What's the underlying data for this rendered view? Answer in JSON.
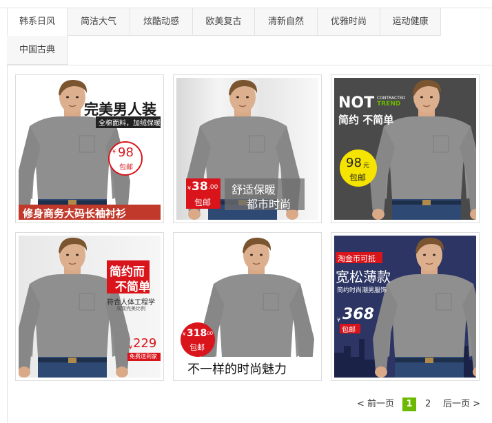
{
  "tabs": [
    {
      "label": "韩系日风",
      "active": true
    },
    {
      "label": "简洁大气"
    },
    {
      "label": "炫酷动感"
    },
    {
      "label": "欧美复古"
    },
    {
      "label": "清新自然"
    },
    {
      "label": "优雅时尚"
    },
    {
      "label": "运动健康"
    },
    {
      "label": "中国古典"
    }
  ],
  "cards": [
    {
      "t1": "完美男人装",
      "t2": "全棉面料，加绒保暖",
      "badge": "98",
      "currency": "¥",
      "badge_sub": "包邮",
      "banner": "修身商务大码长袖衬衫"
    },
    {
      "price": "38",
      "decimals": ".00",
      "currency": "¥",
      "price_sub": "包邮",
      "line1": "舒适保暖",
      "line2": "都市时尚"
    },
    {
      "t1": "NOT",
      "t1_small1": "CONTRACTED",
      "t1_small2": "TREND",
      "t2": "简约 不简单",
      "badge": "98",
      "badge_unit": "元",
      "badge_sub": "包邮"
    },
    {
      "t1": "简约而",
      "t2": "不简单",
      "t3": "符合人体工程学",
      "t4": "展现完美比例",
      "price": "229",
      "currency": "¥",
      "price_sub": "免费送到家"
    },
    {
      "badge": "318",
      "decimals": ".00",
      "currency": "¥",
      "badge_sub": "包邮",
      "banner": "不一样的时尚魅力"
    },
    {
      "tag": "淘金币可抵",
      "t1": "宽松薄款",
      "t2": "简约时尚潮男服饰",
      "price": "368",
      "currency": "¥",
      "price_sub": "包邮"
    }
  ],
  "pager": {
    "prev": "< 前一页",
    "current": "1",
    "page2": "2",
    "next": "后一页 >"
  },
  "colors": {
    "accent_green": "#6cb900",
    "red": "#d9141b",
    "tab_bg": "#f7f7f7",
    "border": "#e2e2e2"
  }
}
